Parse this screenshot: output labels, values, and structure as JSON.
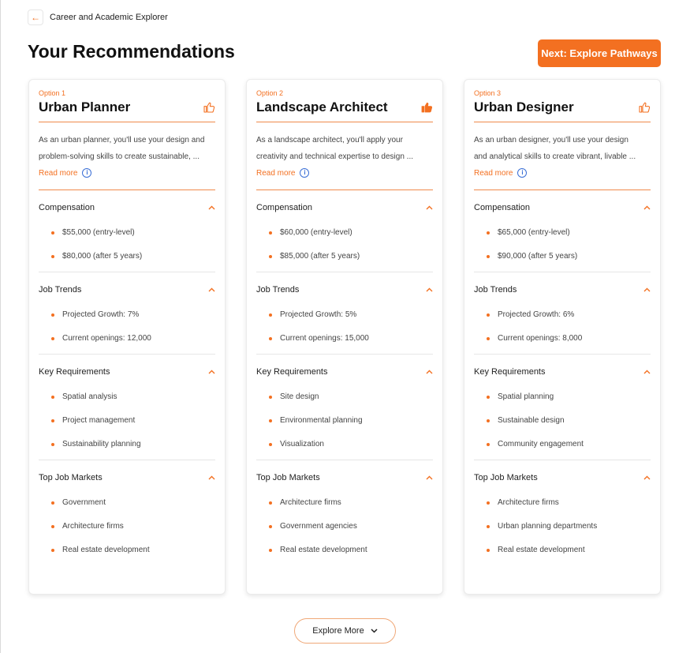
{
  "header": {
    "back_icon": "arrow-left-icon",
    "breadcrumb": "Career and Academic Explorer",
    "title": "Your Recommendations",
    "next_button": "Next: Explore Pathways"
  },
  "colors": {
    "accent": "#f37021",
    "info": "#3b6fd6"
  },
  "cards": [
    {
      "option": "Option 1",
      "title": "Urban Planner",
      "liked": false,
      "description_line1": "As an urban planner, you'll use your design and",
      "description_line2": "problem-solving skills to create sustainable, ...",
      "read_more": "Read more",
      "sections": [
        {
          "title": "Compensation",
          "items": [
            "$55,000 (entry-level)",
            "$80,000 (after 5 years)"
          ]
        },
        {
          "title": "Job Trends",
          "items": [
            "Projected Growth: 7%",
            "Current openings: 12,000"
          ]
        },
        {
          "title": "Key Requirements",
          "items": [
            "Spatial analysis",
            "Project management",
            "Sustainability planning"
          ]
        },
        {
          "title": "Top Job Markets",
          "items": [
            "Government",
            "Architecture firms",
            "Real estate development"
          ]
        }
      ]
    },
    {
      "option": "Option 2",
      "title": "Landscape Architect",
      "liked": true,
      "description_line1": "As a landscape architect, you'll apply your",
      "description_line2": "creativity and technical expertise to design ...",
      "read_more": "Read more",
      "sections": [
        {
          "title": "Compensation",
          "items": [
            "$60,000 (entry-level)",
            "$85,000 (after 5 years)"
          ]
        },
        {
          "title": "Job Trends",
          "items": [
            "Projected Growth: 5%",
            "Current openings: 15,000"
          ]
        },
        {
          "title": "Key Requirements",
          "items": [
            "Site design",
            "Environmental planning",
            "Visualization"
          ]
        },
        {
          "title": "Top Job Markets",
          "items": [
            "Architecture firms",
            "Government agencies",
            "Real estate development"
          ]
        }
      ]
    },
    {
      "option": "Option 3",
      "title": "Urban Designer",
      "liked": false,
      "description_line1": "As an urban designer, you'll use your design",
      "description_line2": "and analytical skills to create vibrant, livable ...",
      "read_more": "Read more",
      "sections": [
        {
          "title": "Compensation",
          "items": [
            "$65,000 (entry-level)",
            "$90,000 (after 5 years)"
          ]
        },
        {
          "title": "Job Trends",
          "items": [
            "Projected Growth: 6%",
            "Current openings: 8,000"
          ]
        },
        {
          "title": "Key Requirements",
          "items": [
            "Spatial planning",
            "Sustainable design",
            "Community engagement"
          ]
        },
        {
          "title": "Top Job Markets",
          "items": [
            "Architecture firms",
            "Urban planning departments",
            "Real estate development"
          ]
        }
      ]
    }
  ],
  "footer": {
    "explore_more": "Explore More"
  }
}
